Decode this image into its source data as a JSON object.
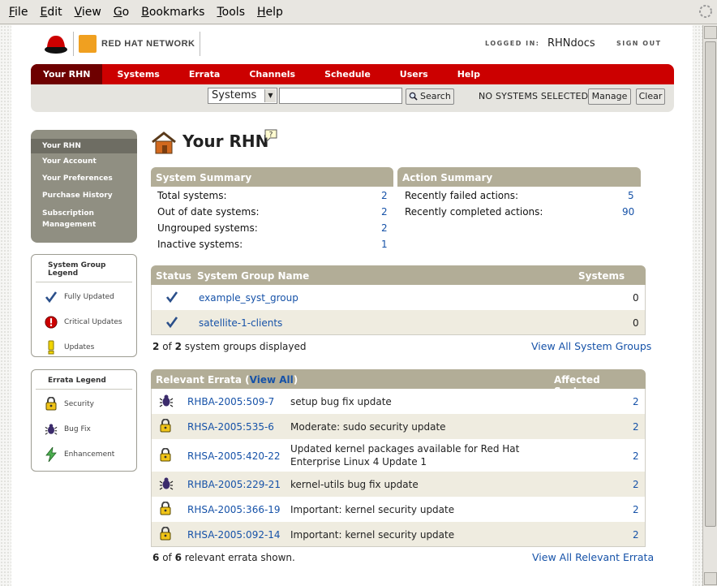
{
  "browser": {
    "menu": [
      {
        "label": "File",
        "u": "F",
        "rest": "ile"
      },
      {
        "label": "Edit",
        "u": "E",
        "rest": "dit"
      },
      {
        "label": "View",
        "u": "V",
        "rest": "iew"
      },
      {
        "label": "Go",
        "u": "G",
        "rest": "o"
      },
      {
        "label": "Bookmarks",
        "u": "B",
        "rest": "ookmarks"
      },
      {
        "label": "Tools",
        "u": "T",
        "rest": "ools"
      },
      {
        "label": "Help",
        "u": "H",
        "rest": "elp"
      }
    ]
  },
  "header": {
    "logo_text": "RED HAT NETWORK",
    "logged_in_label": "LOGGED IN:",
    "username": "RHNdocs",
    "sign_out": "SIGN OUT"
  },
  "nav": {
    "tabs": [
      "Your RHN",
      "Systems",
      "Errata",
      "Channels",
      "Schedule",
      "Users",
      "Help"
    ],
    "active": "Your RHN"
  },
  "search": {
    "scope": "Systems",
    "query": "",
    "button": "Search",
    "no_systems": "NO SYSTEMS SELECTED",
    "manage": "Manage",
    "clear": "Clear"
  },
  "sidebar": {
    "items": [
      "Your RHN",
      "Your Account",
      "Your Preferences",
      "Purchase History",
      "Subscription",
      "Management"
    ]
  },
  "group_legend": {
    "title": "System Group Legend",
    "items": [
      "Fully Updated",
      "Critical Updates",
      "Updates"
    ]
  },
  "errata_legend": {
    "title": "Errata Legend",
    "items": [
      "Security",
      "Bug Fix",
      "Enhancement"
    ]
  },
  "page": {
    "title": "Your RHN"
  },
  "system_summary": {
    "title": "System Summary",
    "rows": [
      {
        "label": "Total systems:",
        "value": "2"
      },
      {
        "label": "Out of date systems:",
        "value": "2"
      },
      {
        "label": "Ungrouped systems:",
        "value": "2"
      },
      {
        "label": "Inactive systems:",
        "value": "1"
      }
    ]
  },
  "action_summary": {
    "title": "Action Summary",
    "rows": [
      {
        "label": "Recently failed actions:",
        "value": "5"
      },
      {
        "label": "Recently completed actions:",
        "value": "90"
      }
    ]
  },
  "groups_table": {
    "headers": {
      "status": "Status",
      "name": "System Group Name",
      "systems": "Systems"
    },
    "rows": [
      {
        "name": "example_syst_group",
        "systems": "0"
      },
      {
        "name": "satellite-1-clients",
        "systems": "0"
      }
    ],
    "footer_count": "2",
    "footer_of": "of",
    "footer_total": "2",
    "footer_suffix": "system groups displayed",
    "view_all": "View All System Groups"
  },
  "errata_table": {
    "title": "Relevant Errata (",
    "view_all_inline": "View All",
    "title_close": ")",
    "affected_header": "Affected Systems",
    "rows": [
      {
        "type": "bugfix",
        "id": "RHBA-2005:509-7",
        "synopsis": "setup bug fix update",
        "synopsis2": "",
        "affected": "2"
      },
      {
        "type": "security",
        "id": "RHSA-2005:535-6",
        "synopsis": "Moderate: sudo security update",
        "synopsis2": "",
        "affected": "2"
      },
      {
        "type": "security",
        "id": "RHSA-2005:420-22",
        "synopsis": "Updated kernel packages available for Red Hat",
        "synopsis2": "Enterprise Linux 4 Update 1",
        "affected": "2"
      },
      {
        "type": "bugfix",
        "id": "RHBA-2005:229-21",
        "synopsis": "kernel-utils bug fix update",
        "synopsis2": "",
        "affected": "2"
      },
      {
        "type": "security",
        "id": "RHSA-2005:366-19",
        "synopsis": "Important: kernel security update",
        "synopsis2": "",
        "affected": "2"
      },
      {
        "type": "security",
        "id": "RHSA-2005:092-14",
        "synopsis": "Important: kernel security update",
        "synopsis2": "",
        "affected": "2"
      }
    ],
    "footer_count": "6",
    "footer_of": "of",
    "footer_total": "6",
    "footer_suffix": "relevant errata shown.",
    "view_all": "View All Relevant Errata"
  },
  "colors": {
    "nav_red": "#cc0000",
    "nav_active": "#6e0000",
    "box_header": "#b2ad97",
    "link": "#1652a8"
  }
}
